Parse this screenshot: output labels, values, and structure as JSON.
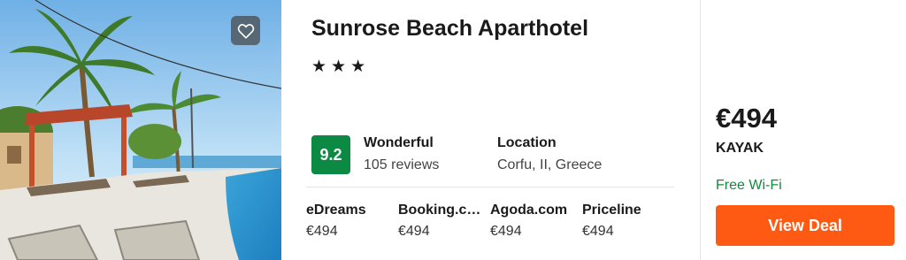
{
  "hotel": {
    "name": "Sunrose Beach Aparthotel",
    "stars_text": "★★★",
    "star_count": 3
  },
  "rating": {
    "score": "9.2",
    "label": "Wonderful",
    "reviews": "105 reviews",
    "color": "#0c8a44"
  },
  "location": {
    "label": "Location",
    "value": "Corfu, II, Greece"
  },
  "providers": [
    {
      "name": "eDreams",
      "price": "€494"
    },
    {
      "name": "Booking.com",
      "price": "€494"
    },
    {
      "name": "Agoda.com",
      "price": "€494"
    },
    {
      "name": "Priceline",
      "price": "€494"
    }
  ],
  "best_deal": {
    "price": "€494",
    "source": "KAYAK",
    "feature": "Free Wi-Fi",
    "button_label": "View Deal",
    "button_color": "#ff5a13",
    "feature_color": "#128a3e"
  },
  "icons": {
    "favorite": "heart-outline-icon"
  }
}
